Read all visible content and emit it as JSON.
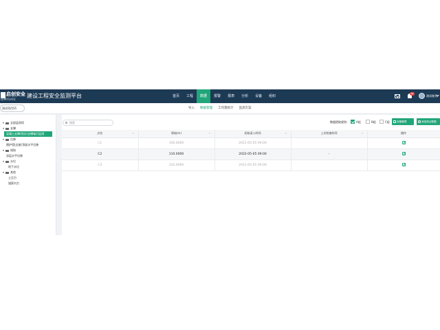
{
  "header": {
    "logo_cn": "启创安全",
    "logo_en": "QIMYSAFE",
    "title": "建设工程安全监测平台",
    "nav": [
      "首页",
      "工程",
      "数据",
      "报警",
      "报表",
      "分析",
      "设备",
      "组织"
    ],
    "active_nav": 2,
    "notification_count": "99",
    "user_name": "测试账号"
  },
  "subbar": {
    "project_select": "测试项目S5",
    "tabs": [
      "导入",
      "数据管理",
      "工作量统计",
      "监测方案"
    ],
    "active_tab": 1
  },
  "sidebar": {
    "tree": [
      {
        "label": "全部监测项",
        "caret": true,
        "folder": true
      },
      {
        "label": "支撑",
        "caret": true,
        "folder": true
      },
      {
        "label": "混凝土支撑(测点)支撑轴力监测",
        "selected": true
      },
      {
        "label": "位移",
        "caret": true,
        "folder": true
      },
      {
        "label": "围护墙(边坡)顶部水平位移"
      },
      {
        "label": "倾斜",
        "caret": true,
        "folder": true
      },
      {
        "label": "深层水平位移"
      },
      {
        "label": "水位",
        "caret": true,
        "folder": true
      },
      {
        "label": "地下水位"
      },
      {
        "label": "其他",
        "caret": true,
        "folder": true
      },
      {
        "label": "土压力"
      },
      {
        "label": "锚索内力"
      }
    ]
  },
  "toolbar": {
    "search_placeholder": "搜索",
    "filter_label": "数据提取规则:",
    "checkboxes": [
      {
        "label": "A组",
        "checked": true
      },
      {
        "label": "B组",
        "checked": false
      },
      {
        "label": "C组",
        "checked": false
      }
    ],
    "buttons": [
      "设备管理",
      "添加测点数据"
    ]
  },
  "table": {
    "columns": [
      "点名",
      "原始(m)",
      "初始读入时间",
      "上次检查时间",
      "操作"
    ],
    "rows": [
      {
        "name": "C1",
        "value": "100.0000",
        "time": "2021-05-05 09:00",
        "last": ""
      },
      {
        "name": "C2",
        "value": "110.0000",
        "time": "2022-05-05 09:00",
        "last": "-"
      },
      {
        "name": "C3",
        "value": "120.0000",
        "time": "2021-05-05 09:00",
        "last": ""
      }
    ]
  },
  "colors": {
    "header_bg": "#1d3a55",
    "accent": "#21a67a",
    "badge": "#e84a4a"
  }
}
